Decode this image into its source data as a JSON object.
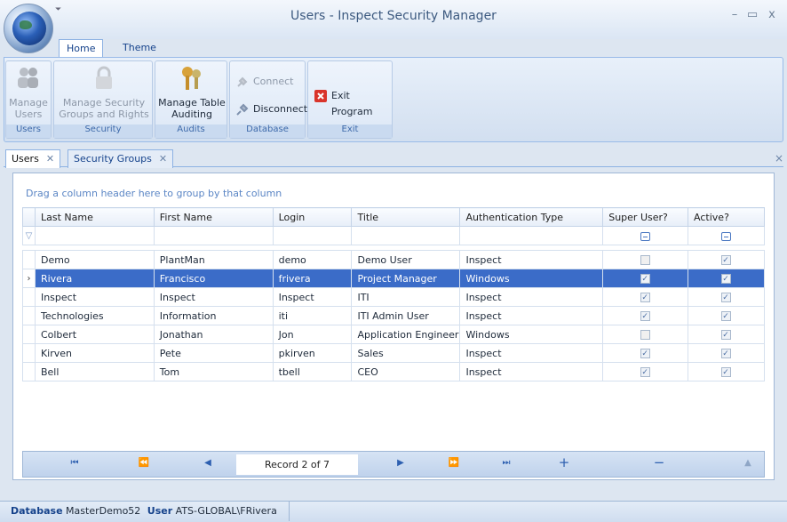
{
  "window": {
    "title": "Users - Inspect Security Manager",
    "qat": "⏷"
  },
  "ribbon": {
    "tabs": [
      "Home",
      "Theme"
    ],
    "groups": [
      {
        "caption": "Users",
        "buttons": [
          {
            "label": "Manage Users",
            "icon": "users-icon",
            "enabled": false
          }
        ]
      },
      {
        "caption": "Security",
        "buttons": [
          {
            "label": "Manage Security Groups and Rights",
            "icon": "lock-icon",
            "enabled": false
          }
        ]
      },
      {
        "caption": "Audits",
        "buttons": [
          {
            "label": "Manage Table Auditing",
            "icon": "keys-icon",
            "enabled": true
          }
        ]
      },
      {
        "caption": "Database",
        "buttons": [
          {
            "label": "Connect",
            "icon": "plug-icon",
            "enabled": false
          },
          {
            "label": "Disconnect",
            "icon": "unplug-icon",
            "enabled": true
          }
        ]
      },
      {
        "caption": "Exit",
        "buttons": [
          {
            "label": "Exit Program",
            "icon": "exit-icon",
            "enabled": true
          }
        ]
      }
    ]
  },
  "doc_tabs": [
    {
      "label": "Users",
      "active": true
    },
    {
      "label": "Security Groups",
      "active": false
    }
  ],
  "grid": {
    "group_hint": "Drag a column header here to group by that column",
    "columns": [
      "Last Name",
      "First Name",
      "Login",
      "Title",
      "Authentication Type",
      "Super User?",
      "Active?"
    ],
    "rows": [
      {
        "last": "Demo",
        "first": "PlantMan",
        "login": "demo",
        "title": "Demo User",
        "auth": "Inspect",
        "super": false,
        "active": true,
        "selected": false
      },
      {
        "last": "Rivera",
        "first": "Francisco",
        "login": "frivera",
        "title": "Project Manager",
        "auth": "Windows",
        "super": true,
        "active": true,
        "selected": true
      },
      {
        "last": "Inspect",
        "first": "Inspect",
        "login": "Inspect",
        "title": "ITI",
        "auth": "Inspect",
        "super": true,
        "active": true,
        "selected": false
      },
      {
        "last": "Technologies",
        "first": "Information",
        "login": "iti",
        "title": "ITI Admin User",
        "auth": "Inspect",
        "super": true,
        "active": true,
        "selected": false
      },
      {
        "last": "Colbert",
        "first": "Jonathan",
        "login": "Jon",
        "title": "Application Engineer",
        "auth": "Windows",
        "super": false,
        "active": true,
        "selected": false
      },
      {
        "last": "Kirven",
        "first": "Pete",
        "login": "pkirven",
        "title": "Sales",
        "auth": "Inspect",
        "super": true,
        "active": true,
        "selected": false
      },
      {
        "last": "Bell",
        "first": "Tom",
        "login": "tbell",
        "title": "CEO",
        "auth": "Inspect",
        "super": true,
        "active": true,
        "selected": false
      }
    ]
  },
  "navigator": {
    "record_text": "Record 2 of 7"
  },
  "status": {
    "db_label": "Database",
    "db_value": "MasterDemo52",
    "user_label": "User",
    "user_value": "ATS-GLOBAL\\FRivera"
  },
  "colors": {
    "accent": "#3b6cc8",
    "ribbon": "#d2dff0"
  }
}
